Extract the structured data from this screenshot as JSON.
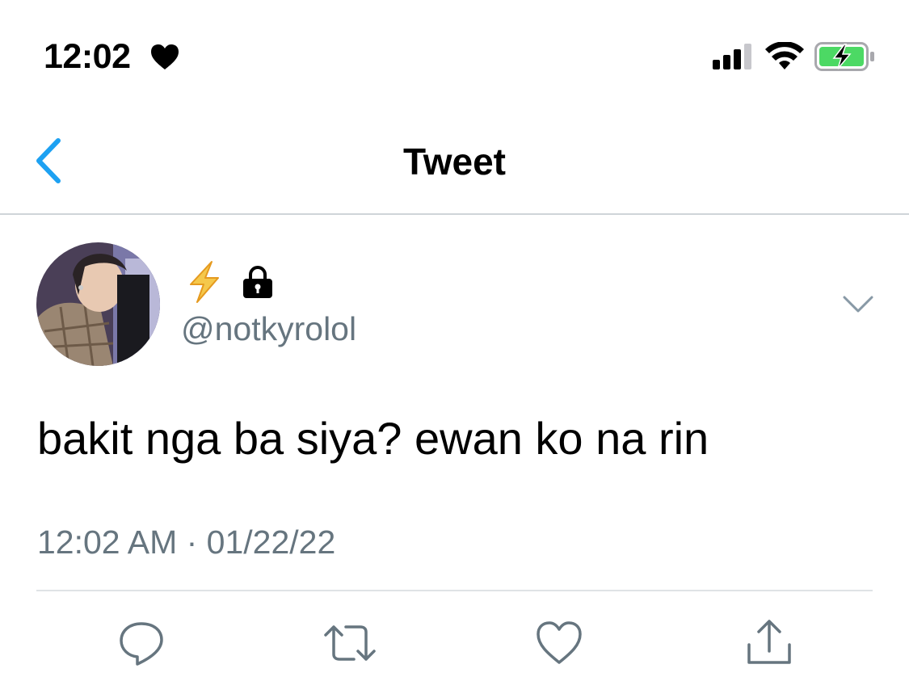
{
  "status_bar": {
    "time": "12:02",
    "heart_icon": "heart-icon",
    "signal_icon": "cellular-signal-icon",
    "wifi_icon": "wifi-icon",
    "battery_icon": "battery-charging-icon",
    "battery_color": "#4cd964"
  },
  "nav": {
    "back_icon": "chevron-left-icon",
    "title": "Tweet",
    "accent_color": "#1da1f2"
  },
  "author": {
    "avatar": "avatar-photo",
    "badge_icons": [
      "lightning-bolt-icon",
      "lock-icon"
    ],
    "handle": "@notkyrolol",
    "menu_icon": "chevron-down-icon"
  },
  "tweet": {
    "text": "bakit nga ba siya? ewan ko na rin",
    "timestamp": "12:02 AM · 01/22/22"
  },
  "actions": [
    {
      "icon": "reply-icon"
    },
    {
      "icon": "retweet-icon"
    },
    {
      "icon": "like-heart-icon"
    },
    {
      "icon": "share-icon"
    }
  ]
}
